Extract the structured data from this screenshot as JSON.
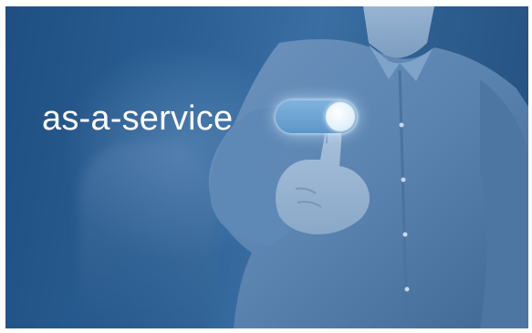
{
  "headline": {
    "text": "as-a-service"
  },
  "toggle": {
    "state": "on",
    "track_color": "#6aa3d4",
    "knob_color": "#e8f3fc"
  },
  "colors": {
    "background_tint": "#2a5e93",
    "text": "#ffffff"
  },
  "scene": {
    "subject_icon": "man-touching-toggle-icon"
  }
}
